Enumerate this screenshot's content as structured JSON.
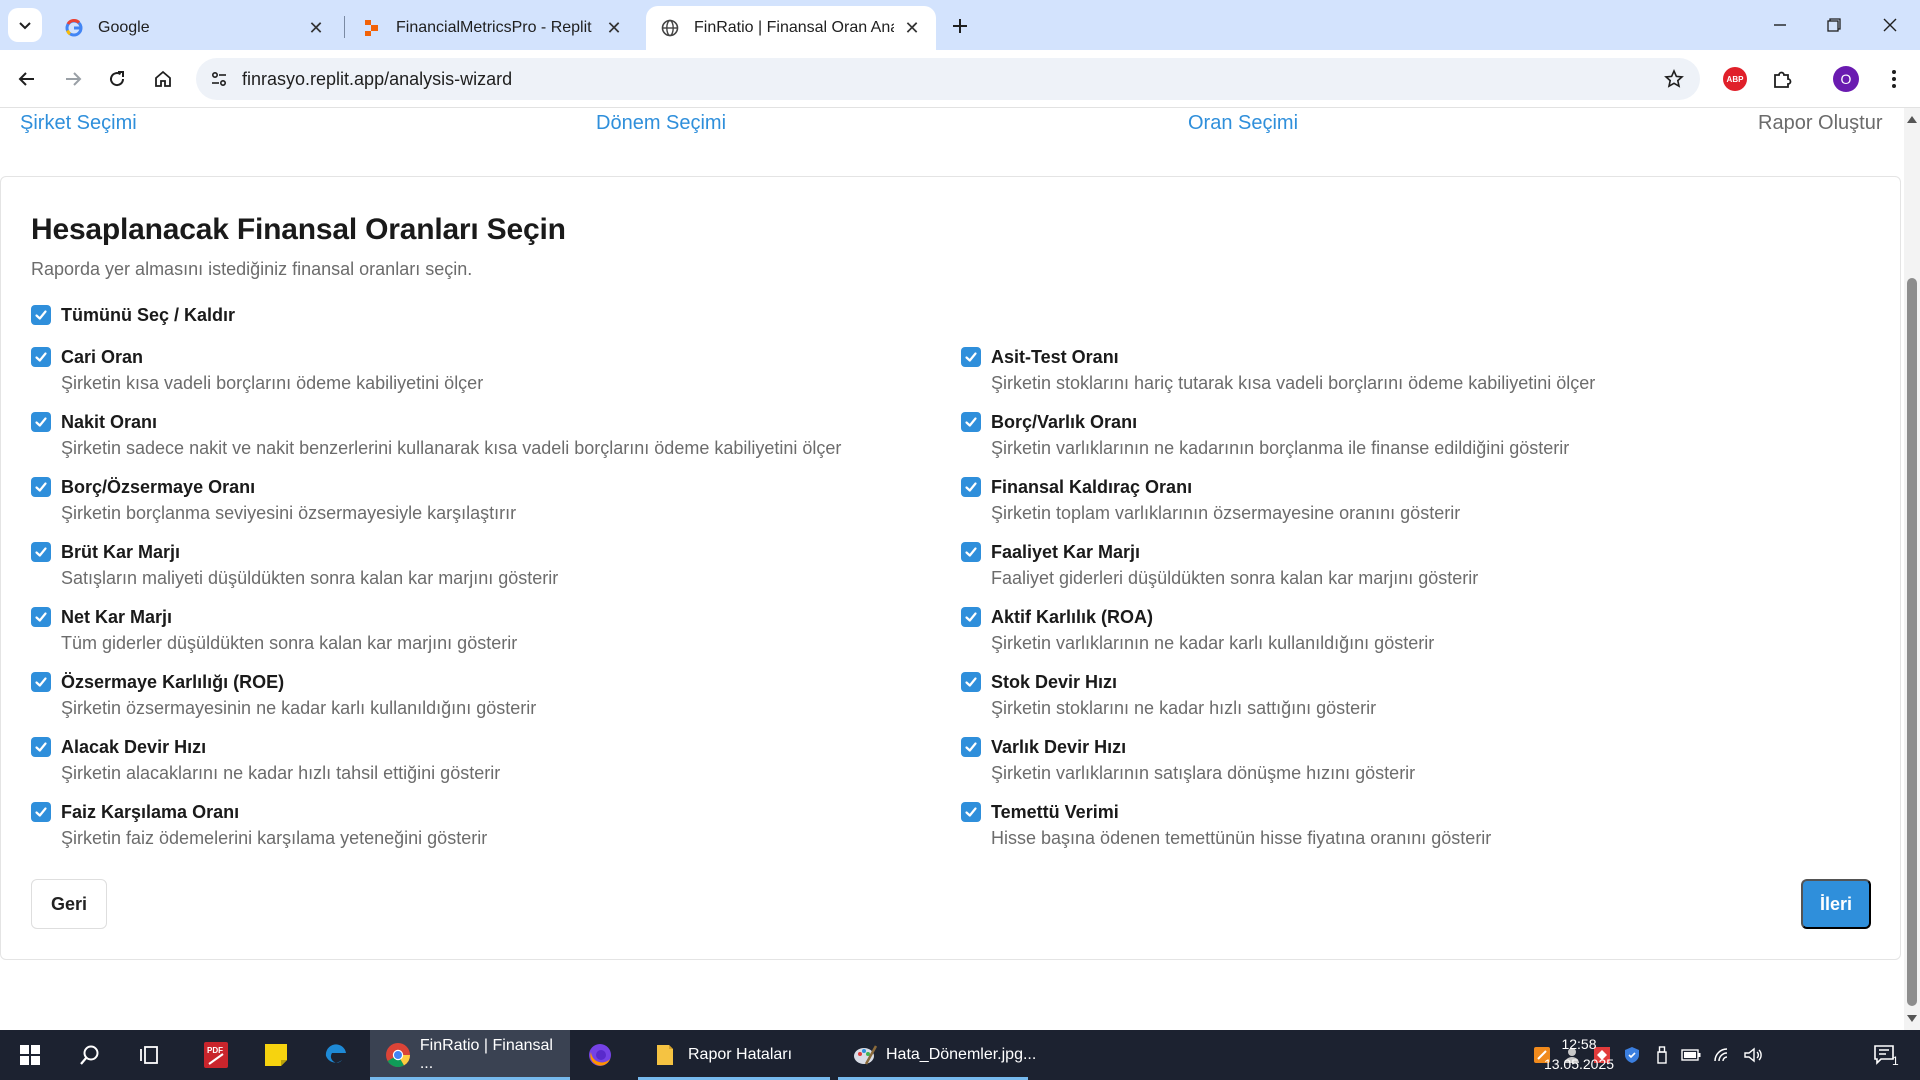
{
  "browser": {
    "tabs": [
      {
        "title": "Google",
        "icon": "google-icon"
      },
      {
        "title": "FinancialMetricsPro - Replit",
        "icon": "replit-icon"
      },
      {
        "title": "FinRatio | Finansal Oran Analiz P",
        "icon": "globe-icon",
        "active": true
      }
    ],
    "url": "finrasyo.replit.app/analysis-wizard",
    "profile_initial": "O",
    "abp_label": "ABP"
  },
  "steps": [
    "Şirket Seçimi",
    "Dönem Seçimi",
    "Oran Seçimi",
    "Rapor Oluştur"
  ],
  "page": {
    "title": "Hesaplanacak Finansal Oranları Seçin",
    "subtitle": "Raporda yer almasını istediğiniz finansal oranları seçin.",
    "select_all": "Tümünü Seç / Kaldır",
    "back": "Geri",
    "next": "İleri"
  },
  "ratios": {
    "left": [
      {
        "name": "Cari Oran",
        "desc": "Şirketin kısa vadeli borçlarını ödeme kabiliyetini ölçer",
        "checked": true
      },
      {
        "name": "Nakit Oranı",
        "desc": "Şirketin sadece nakit ve nakit benzerlerini kullanarak kısa vadeli borçlarını ödeme kabiliyetini ölçer",
        "checked": true
      },
      {
        "name": "Borç/Özsermaye Oranı",
        "desc": "Şirketin borçlanma seviyesini özsermayesiyle karşılaştırır",
        "checked": true
      },
      {
        "name": "Brüt Kar Marjı",
        "desc": "Satışların maliyeti düşüldükten sonra kalan kar marjını gösterir",
        "checked": true
      },
      {
        "name": "Net Kar Marjı",
        "desc": "Tüm giderler düşüldükten sonra kalan kar marjını gösterir",
        "checked": true
      },
      {
        "name": "Özsermaye Karlılığı (ROE)",
        "desc": "Şirketin özsermayesinin ne kadar karlı kullanıldığını gösterir",
        "checked": true
      },
      {
        "name": "Alacak Devir Hızı",
        "desc": "Şirketin alacaklarını ne kadar hızlı tahsil ettiğini gösterir",
        "checked": true
      },
      {
        "name": "Faiz Karşılama Oranı",
        "desc": "Şirketin faiz ödemelerini karşılama yeteneğini gösterir",
        "checked": true
      }
    ],
    "right": [
      {
        "name": "Asit-Test Oranı",
        "desc": "Şirketin stoklarını hariç tutarak kısa vadeli borçlarını ödeme kabiliyetini ölçer",
        "checked": true
      },
      {
        "name": "Borç/Varlık Oranı",
        "desc": "Şirketin varlıklarının ne kadarının borçlanma ile finanse edildiğini gösterir",
        "checked": true
      },
      {
        "name": "Finansal Kaldıraç Oranı",
        "desc": "Şirketin toplam varlıklarının özsermayesine oranını gösterir",
        "checked": true
      },
      {
        "name": "Faaliyet Kar Marjı",
        "desc": "Faaliyet giderleri düşüldükten sonra kalan kar marjını gösterir",
        "checked": true
      },
      {
        "name": "Aktif Karlılık (ROA)",
        "desc": "Şirketin varlıklarının ne kadar karlı kullanıldığını gösterir",
        "checked": true
      },
      {
        "name": "Stok Devir Hızı",
        "desc": "Şirketin stoklarını ne kadar hızlı sattığını gösterir",
        "checked": true
      },
      {
        "name": "Varlık Devir Hızı",
        "desc": "Şirketin varlıklarının satışlara dönüşme hızını gösterir",
        "checked": true
      },
      {
        "name": "Temettü Verimi",
        "desc": "Hisse başına ödenen temettünün hisse fiyatına oranını gösterir",
        "checked": true
      }
    ]
  },
  "taskbar": {
    "apps": [
      {
        "label": "FinRatio | Finansal ...",
        "icon": "chrome-icon",
        "active": true
      },
      {
        "label": "Rapor Hataları",
        "icon": "folder-icon"
      },
      {
        "label": "Hata_Dönemler.jpg...",
        "icon": "paint-icon"
      }
    ],
    "time": "12:58",
    "date": "13.05.2025",
    "notification_count": "1"
  },
  "colors": {
    "accent": "#2f8fdb",
    "tabstrip": "#d3e3fd",
    "taskbar": "#1c2230"
  }
}
